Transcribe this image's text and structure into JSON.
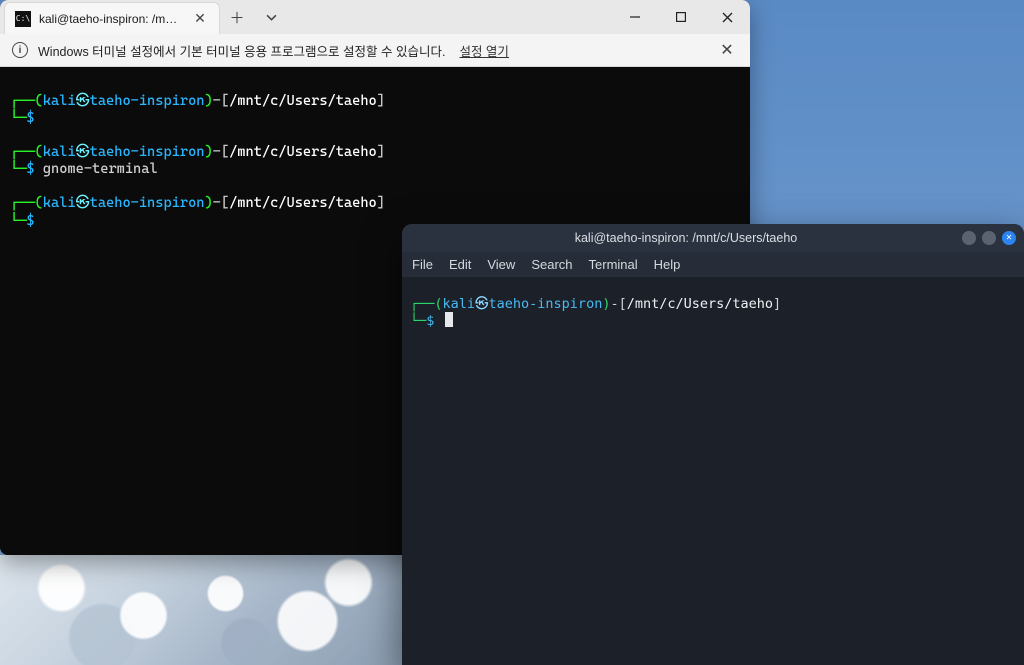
{
  "windows_terminal": {
    "tab": {
      "icon_text": "C:\\",
      "title": "kali@taeho-inspiron: /mnt/c/U"
    },
    "infobar": {
      "message": "Windows 터미널 설정에서 기본 터미널 응용 프로그램으로 설정할 수 있습니다.",
      "link": "설정 열기"
    },
    "prompts": [
      {
        "user": "kali",
        "host": "taeho-inspiron",
        "path": "/mnt/c/Users/taeho",
        "command": ""
      },
      {
        "user": "kali",
        "host": "taeho-inspiron",
        "path": "/mnt/c/Users/taeho",
        "command": "gnome-terminal"
      },
      {
        "user": "kali",
        "host": "taeho-inspiron",
        "path": "/mnt/c/Users/taeho",
        "command": ""
      }
    ]
  },
  "gnome_terminal": {
    "title": "kali@taeho-inspiron: /mnt/c/Users/taeho",
    "menubar": [
      "File",
      "Edit",
      "View",
      "Search",
      "Terminal",
      "Help"
    ],
    "prompt": {
      "user": "kali",
      "host": "taeho-inspiron",
      "path": "/mnt/c/Users/taeho"
    }
  },
  "glyphs": {
    "skull": "㉿"
  }
}
